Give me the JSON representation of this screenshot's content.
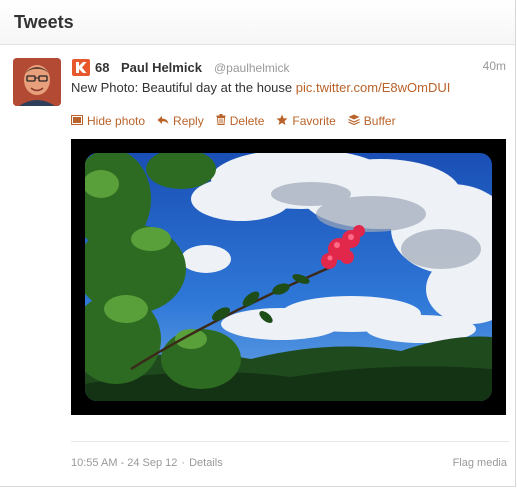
{
  "header": {
    "title": "Tweets"
  },
  "tweet": {
    "klout_score": "68",
    "full_name": "Paul Helmick",
    "screen_name": "@paulhelmick",
    "time_ago": "40m",
    "text": "New Photo: Beautiful day at the house ",
    "link_text": "pic.twitter.com/E8wOmDUI",
    "accent_color": "#b9632a",
    "actions": [
      {
        "label": "Hide photo",
        "icon": "photo-icon"
      },
      {
        "label": "Reply",
        "icon": "reply-icon"
      },
      {
        "label": "Delete",
        "icon": "trash-icon"
      },
      {
        "label": "Favorite",
        "icon": "star-icon"
      },
      {
        "label": "Buffer",
        "icon": "buffer-icon"
      }
    ],
    "footer": {
      "datetime": "10:55 AM - 24 Sep 12",
      "separator": "·",
      "details": "Details",
      "flag": "Flag media"
    }
  }
}
